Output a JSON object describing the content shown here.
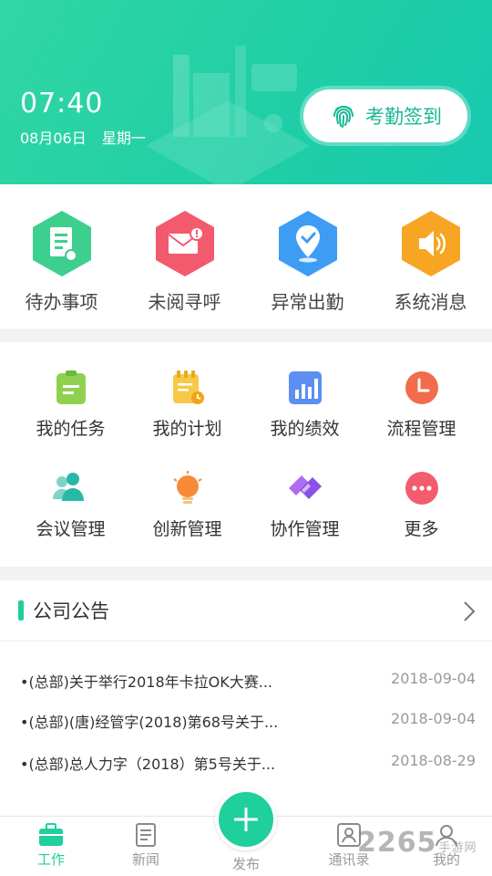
{
  "header": {
    "time": "07:40",
    "date": "08月06日",
    "weekday": "星期一",
    "checkin_label": "考勤签到"
  },
  "quick": [
    {
      "label": "待办事项",
      "icon": "todo-icon",
      "color": "#3ccf8e"
    },
    {
      "label": "未阅寻呼",
      "icon": "mail-icon",
      "color": "#f35a6d"
    },
    {
      "label": "异常出勤",
      "icon": "location-check-icon",
      "color": "#3f9cf5"
    },
    {
      "label": "系统消息",
      "icon": "speaker-icon",
      "color": "#f6a623"
    }
  ],
  "grid": [
    {
      "label": "我的任务",
      "icon": "task-icon"
    },
    {
      "label": "我的计划",
      "icon": "plan-icon"
    },
    {
      "label": "我的绩效",
      "icon": "performance-icon"
    },
    {
      "label": "流程管理",
      "icon": "clock-icon"
    },
    {
      "label": "会议管理",
      "icon": "meeting-icon"
    },
    {
      "label": "创新管理",
      "icon": "lightbulb-icon"
    },
    {
      "label": "协作管理",
      "icon": "handshake-icon"
    },
    {
      "label": "更多",
      "icon": "more-icon"
    }
  ],
  "notice": {
    "title": "公司公告",
    "items": [
      {
        "text": "(总部)关于举行2018年卡拉OK大赛...",
        "date": "2018-09-04"
      },
      {
        "text": "(总部)(唐)经管字(2018)第68号关于...",
        "date": "2018-09-04"
      },
      {
        "text": "(总部)总人力字（2018）第5号关于...",
        "date": "2018-08-29"
      }
    ]
  },
  "tabs": [
    {
      "label": "工作",
      "icon": "briefcase-icon",
      "active": true
    },
    {
      "label": "新闻",
      "icon": "news-icon",
      "active": false
    },
    {
      "label": "发布",
      "icon": "plus-icon",
      "active": false
    },
    {
      "label": "通讯录",
      "icon": "contacts-icon",
      "active": false
    },
    {
      "label": "我的",
      "icon": "profile-icon",
      "active": false
    }
  ],
  "watermark": {
    "main": "2265",
    "sub": "手游网 .com"
  }
}
